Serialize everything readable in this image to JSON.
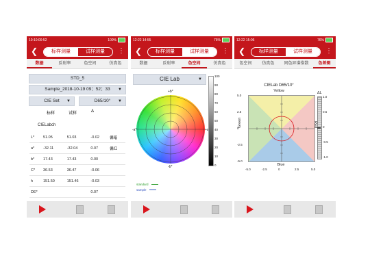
{
  "app": {
    "seg_standard": "标样测量",
    "seg_sample": "试样测量",
    "colors": {
      "brand": "#c4161c",
      "accent_play": "#d9151c"
    }
  },
  "screens": [
    {
      "time": "10:10:00:52",
      "status_right": "100%",
      "tabs": [
        "数据",
        "反射率",
        "色空间",
        "仿真色"
      ],
      "standard": "STD_5",
      "sample": "Sample_2018-10-19 09：52：33",
      "colorspace": "CIE Set",
      "illuminant": "D65/10°",
      "headers": [
        "标样",
        "试样",
        "Δ"
      ],
      "space_name": "CIELabch",
      "rows": [
        {
          "name": "L*",
          "std": "51.05",
          "smp": "51.03",
          "delta": "-0.02",
          "note": "偏暗"
        },
        {
          "name": "a*",
          "std": "-32.11",
          "smp": "-32.04",
          "delta": "0.07",
          "note": "偏红"
        },
        {
          "name": "b*",
          "std": "17.43",
          "smp": "17.43",
          "delta": "0.00",
          "note": ""
        },
        {
          "name": "C*",
          "std": "36.53",
          "smp": "36.47",
          "delta": "-0.06",
          "note": ""
        },
        {
          "name": "h",
          "std": "151.50",
          "smp": "151.46",
          "delta": "-0.03",
          "note": ""
        },
        {
          "name": "DE*",
          "std": "",
          "smp": "",
          "delta": "0.07",
          "note": ""
        }
      ]
    },
    {
      "time": "12:22 14:55",
      "status_right": "76%",
      "tabs": [
        "数据",
        "反射率",
        "色空间",
        "仿真色"
      ],
      "dropdown": "CIE Lab",
      "axes": [
        "+b*",
        "-b*",
        "-a*",
        "+a*"
      ],
      "scale_ticks": [
        "100",
        "90",
        "80",
        "70",
        "60",
        "50",
        "40",
        "30",
        "20",
        "10",
        "0"
      ],
      "legend": [
        "standard",
        "sample"
      ]
    },
    {
      "time": "12:22 15:06",
      "status_right": "76%",
      "tabs": [
        "色空间",
        "仿真色",
        "同色异谱指数",
        "色差图"
      ],
      "title": "CIELab D65/10°",
      "top": "Yellow",
      "bottom": "Blue",
      "left": "Green",
      "right": "Red",
      "dl": "ΔL",
      "y_ticks": [
        "5.0",
        "2.5",
        "0",
        "-2.5",
        "-5.0"
      ],
      "x_ticks": [
        "-5.0",
        "-2.5",
        "0",
        "2.5",
        "5.0"
      ],
      "dl_ticks": [
        "1.0",
        "0.5",
        "0",
        "-0.5",
        "-1.0"
      ]
    }
  ]
}
